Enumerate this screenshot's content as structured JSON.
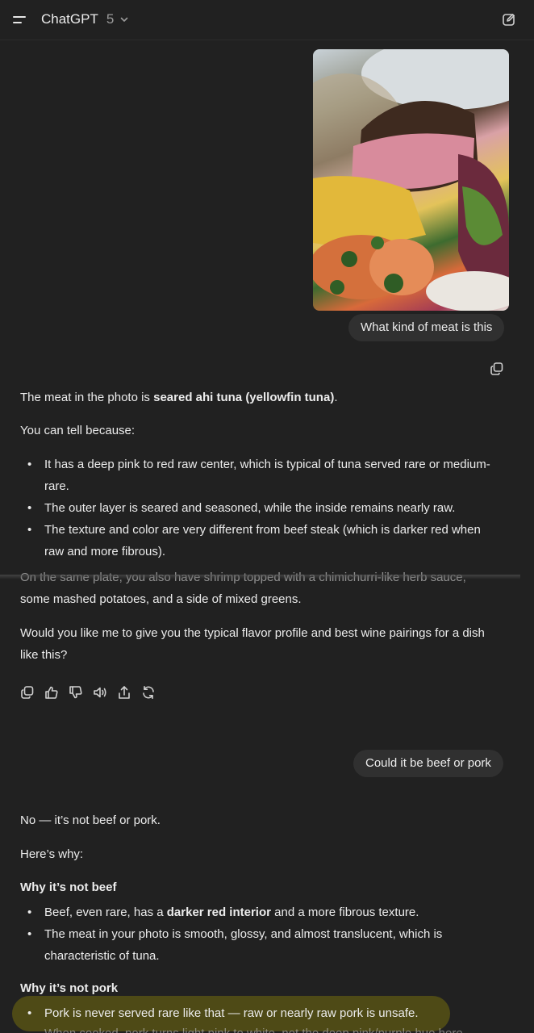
{
  "header": {
    "model_name": "ChatGPT",
    "model_version": "5"
  },
  "conversation": {
    "user_message_1": "What kind of meat is this",
    "assistant_1": {
      "p1_pre": "The meat in the photo is ",
      "p1_bold": "seared ahi tuna (yellowfin tuna)",
      "p1_post": ".",
      "p2": "You can tell because:",
      "bullets": [
        {
          "line1": "It has a deep pink to red raw center, which is typical of tuna served rare or medium-",
          "line2": "rare."
        },
        {
          "line1": "The outer layer is seared and seasoned, while the inside remains nearly raw."
        },
        {
          "line1": "The texture and color are very different from beef steak (which is darker red when",
          "line2": "raw and more fibrous)."
        }
      ],
      "p3_line1": "On the same plate, you also have shrimp topped with a chimichurri-like herb sauce,",
      "p3_line2": "some mashed potatoes, and a side of mixed greens.",
      "p4_line1": "Would you like me to give you the typical flavor profile and best wine pairings for a dish",
      "p4_line2": "like this?"
    },
    "user_message_2": "Could it be beef or pork",
    "assistant_2": {
      "p1": "No — it’s not beef or pork.",
      "p2": "Here’s why:",
      "h_beef": "Why it’s not beef",
      "beef_b1_pre": "Beef, even rare, has a ",
      "beef_b1_bold": "darker red interior",
      "beef_b1_post": " and a more fibrous texture.",
      "beef_b2_line1": "The meat in your photo is smooth, glossy, and almost translucent, which is",
      "beef_b2_line2": "characteristic of tuna.",
      "h_pork": "Why it’s not pork",
      "pork_b1": "Pork is never served rare like that — raw or nearly raw pork is unsafe.",
      "pork_b2_cut": "When cooked, pork turns light pink to white, not the deep pink/purple hue here."
    }
  },
  "icons": [
    "menu-icon",
    "chevron-down-icon",
    "new-chat-icon",
    "copy-icon",
    "thumbs-up-icon",
    "thumbs-down-icon",
    "speaker-icon",
    "share-icon",
    "regenerate-icon"
  ],
  "colors": {
    "background": "#212121",
    "bubble": "#303030",
    "highlight": "#4e4a16",
    "text": "#ececec"
  }
}
